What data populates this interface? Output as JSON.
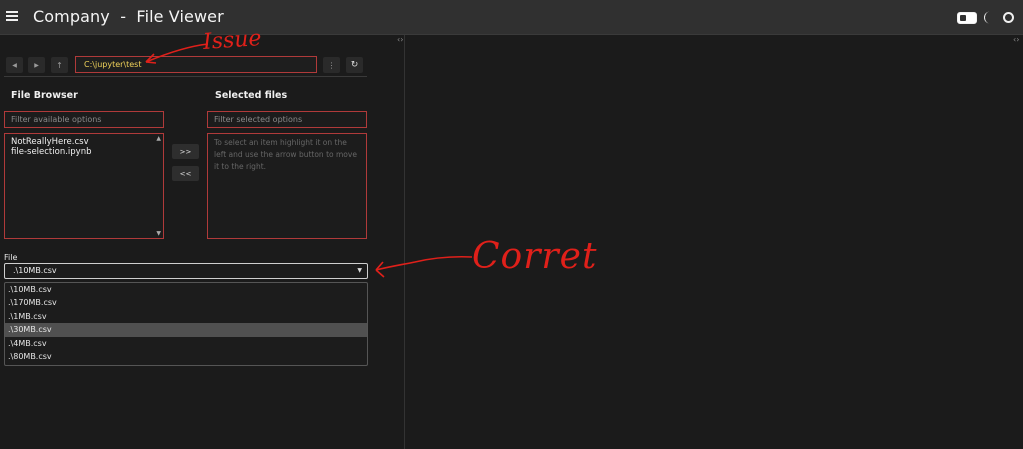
{
  "header": {
    "title": "Company  -  File Viewer"
  },
  "toolbar": {
    "back_icon": "◀",
    "forward_icon": "▶",
    "up_icon": "↑",
    "path_value": "C:\\jupyter\\test",
    "menu_icon": "⋮",
    "refresh_icon": "↻"
  },
  "file_browser": {
    "title": "File Browser",
    "filter_placeholder": "Filter available options",
    "items": [
      "NotReallyHere.csv",
      "file-selection.ipynb"
    ]
  },
  "selected_files": {
    "title": "Selected files",
    "filter_placeholder": "Filter selected options",
    "help_text": "To select an item highlight it on the left and use the arrow button to move it to the right."
  },
  "move_buttons": {
    "add_label": ">>",
    "remove_label": "<<"
  },
  "file_select": {
    "label": "File",
    "selected_value": ".\\10MB.csv",
    "options": [
      ".\\10MB.csv",
      ".\\170MB.csv",
      ".\\1MB.csv",
      ".\\30MB.csv",
      ".\\4MB.csv",
      ".\\80MB.csv"
    ],
    "highlighted_index": 3
  },
  "annotations": {
    "issue_text": "Issue",
    "correct_text": "Corret"
  },
  "colors": {
    "accent_border": "#b03a3a",
    "path_text": "#f0d25a",
    "annotation": "#e0201a"
  }
}
